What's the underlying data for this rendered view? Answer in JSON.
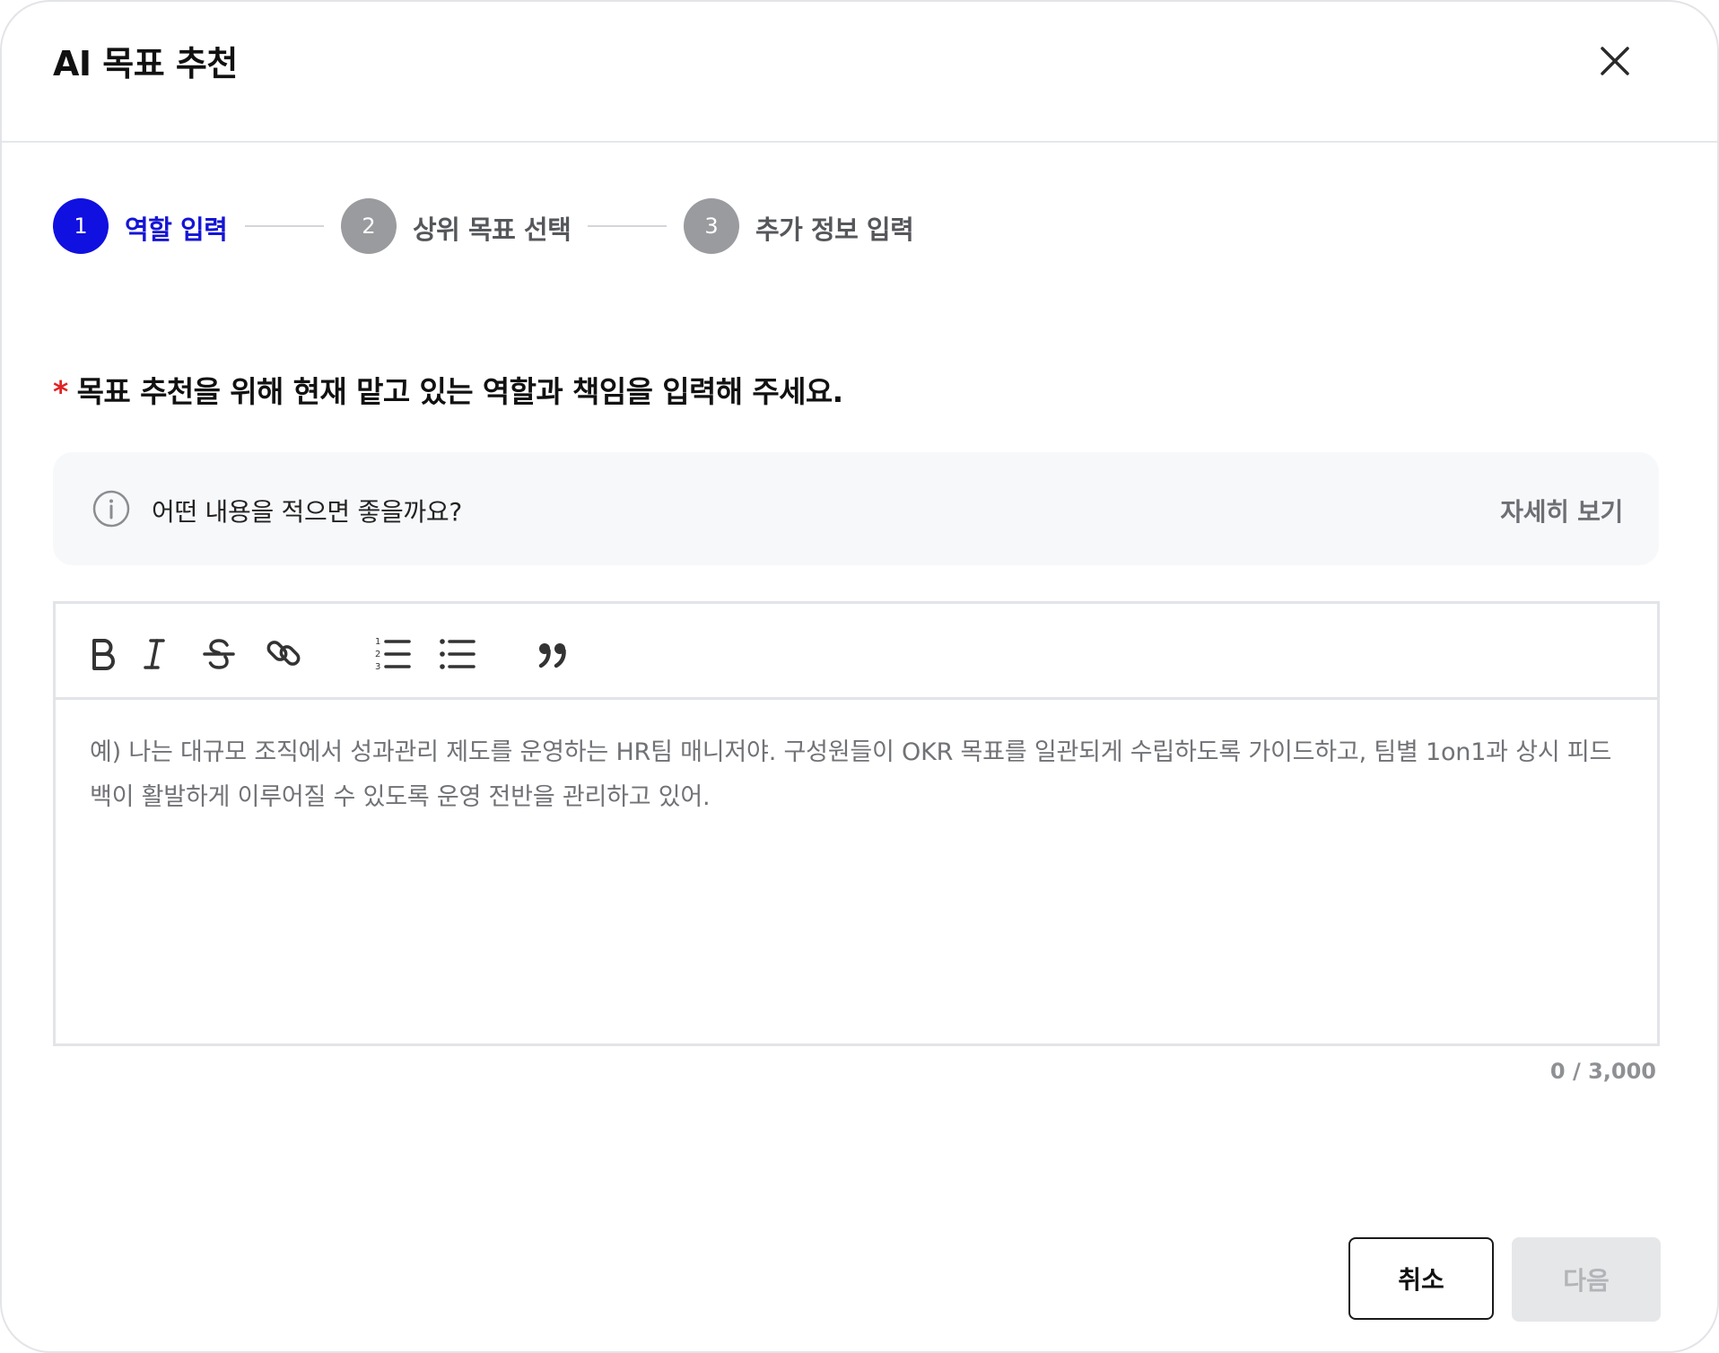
{
  "dialog": {
    "title": "AI 목표 추천",
    "close_icon": "close-icon"
  },
  "stepper": {
    "steps": [
      {
        "number": "1",
        "label": "역할 입력",
        "state": "active"
      },
      {
        "number": "2",
        "label": "상위 목표 선택",
        "state": "inactive"
      },
      {
        "number": "3",
        "label": "추가 정보 입력",
        "state": "inactive"
      }
    ]
  },
  "question": {
    "required_mark": "*",
    "text": "목표 추천을 위해 현재 맡고 있는 역할과 책임을 입력해 주세요."
  },
  "info": {
    "icon": "info-icon",
    "text": "어떤 내용을 적으면 좋을까요?",
    "link_label": "자세히 보기"
  },
  "editor": {
    "toolbar": [
      "bold-icon",
      "italic-icon",
      "strikethrough-icon",
      "link-icon",
      "ordered-list-icon",
      "bullet-list-icon",
      "quote-icon"
    ],
    "placeholder": "예) 나는 대규모 조직에서 성과관리 제도를 운영하는 HR팀 매니저야. 구성원들이 OKR 목표를 일관되게 수립하도록 가이드하고, 팀별 1on1과 상시 피드백이 활발하게 이루어질 수 있도록 운영 전반을 관리하고 있어.",
    "value": "",
    "char_count": "0 / 3,000"
  },
  "footer": {
    "cancel_label": "취소",
    "next_label": "다음"
  },
  "colors": {
    "accent": "#1010e0",
    "step_inactive": "#9a9b9e",
    "required": "#e02424",
    "disabled_bg": "#e6e7e9",
    "disabled_text": "#b3b4b8"
  }
}
